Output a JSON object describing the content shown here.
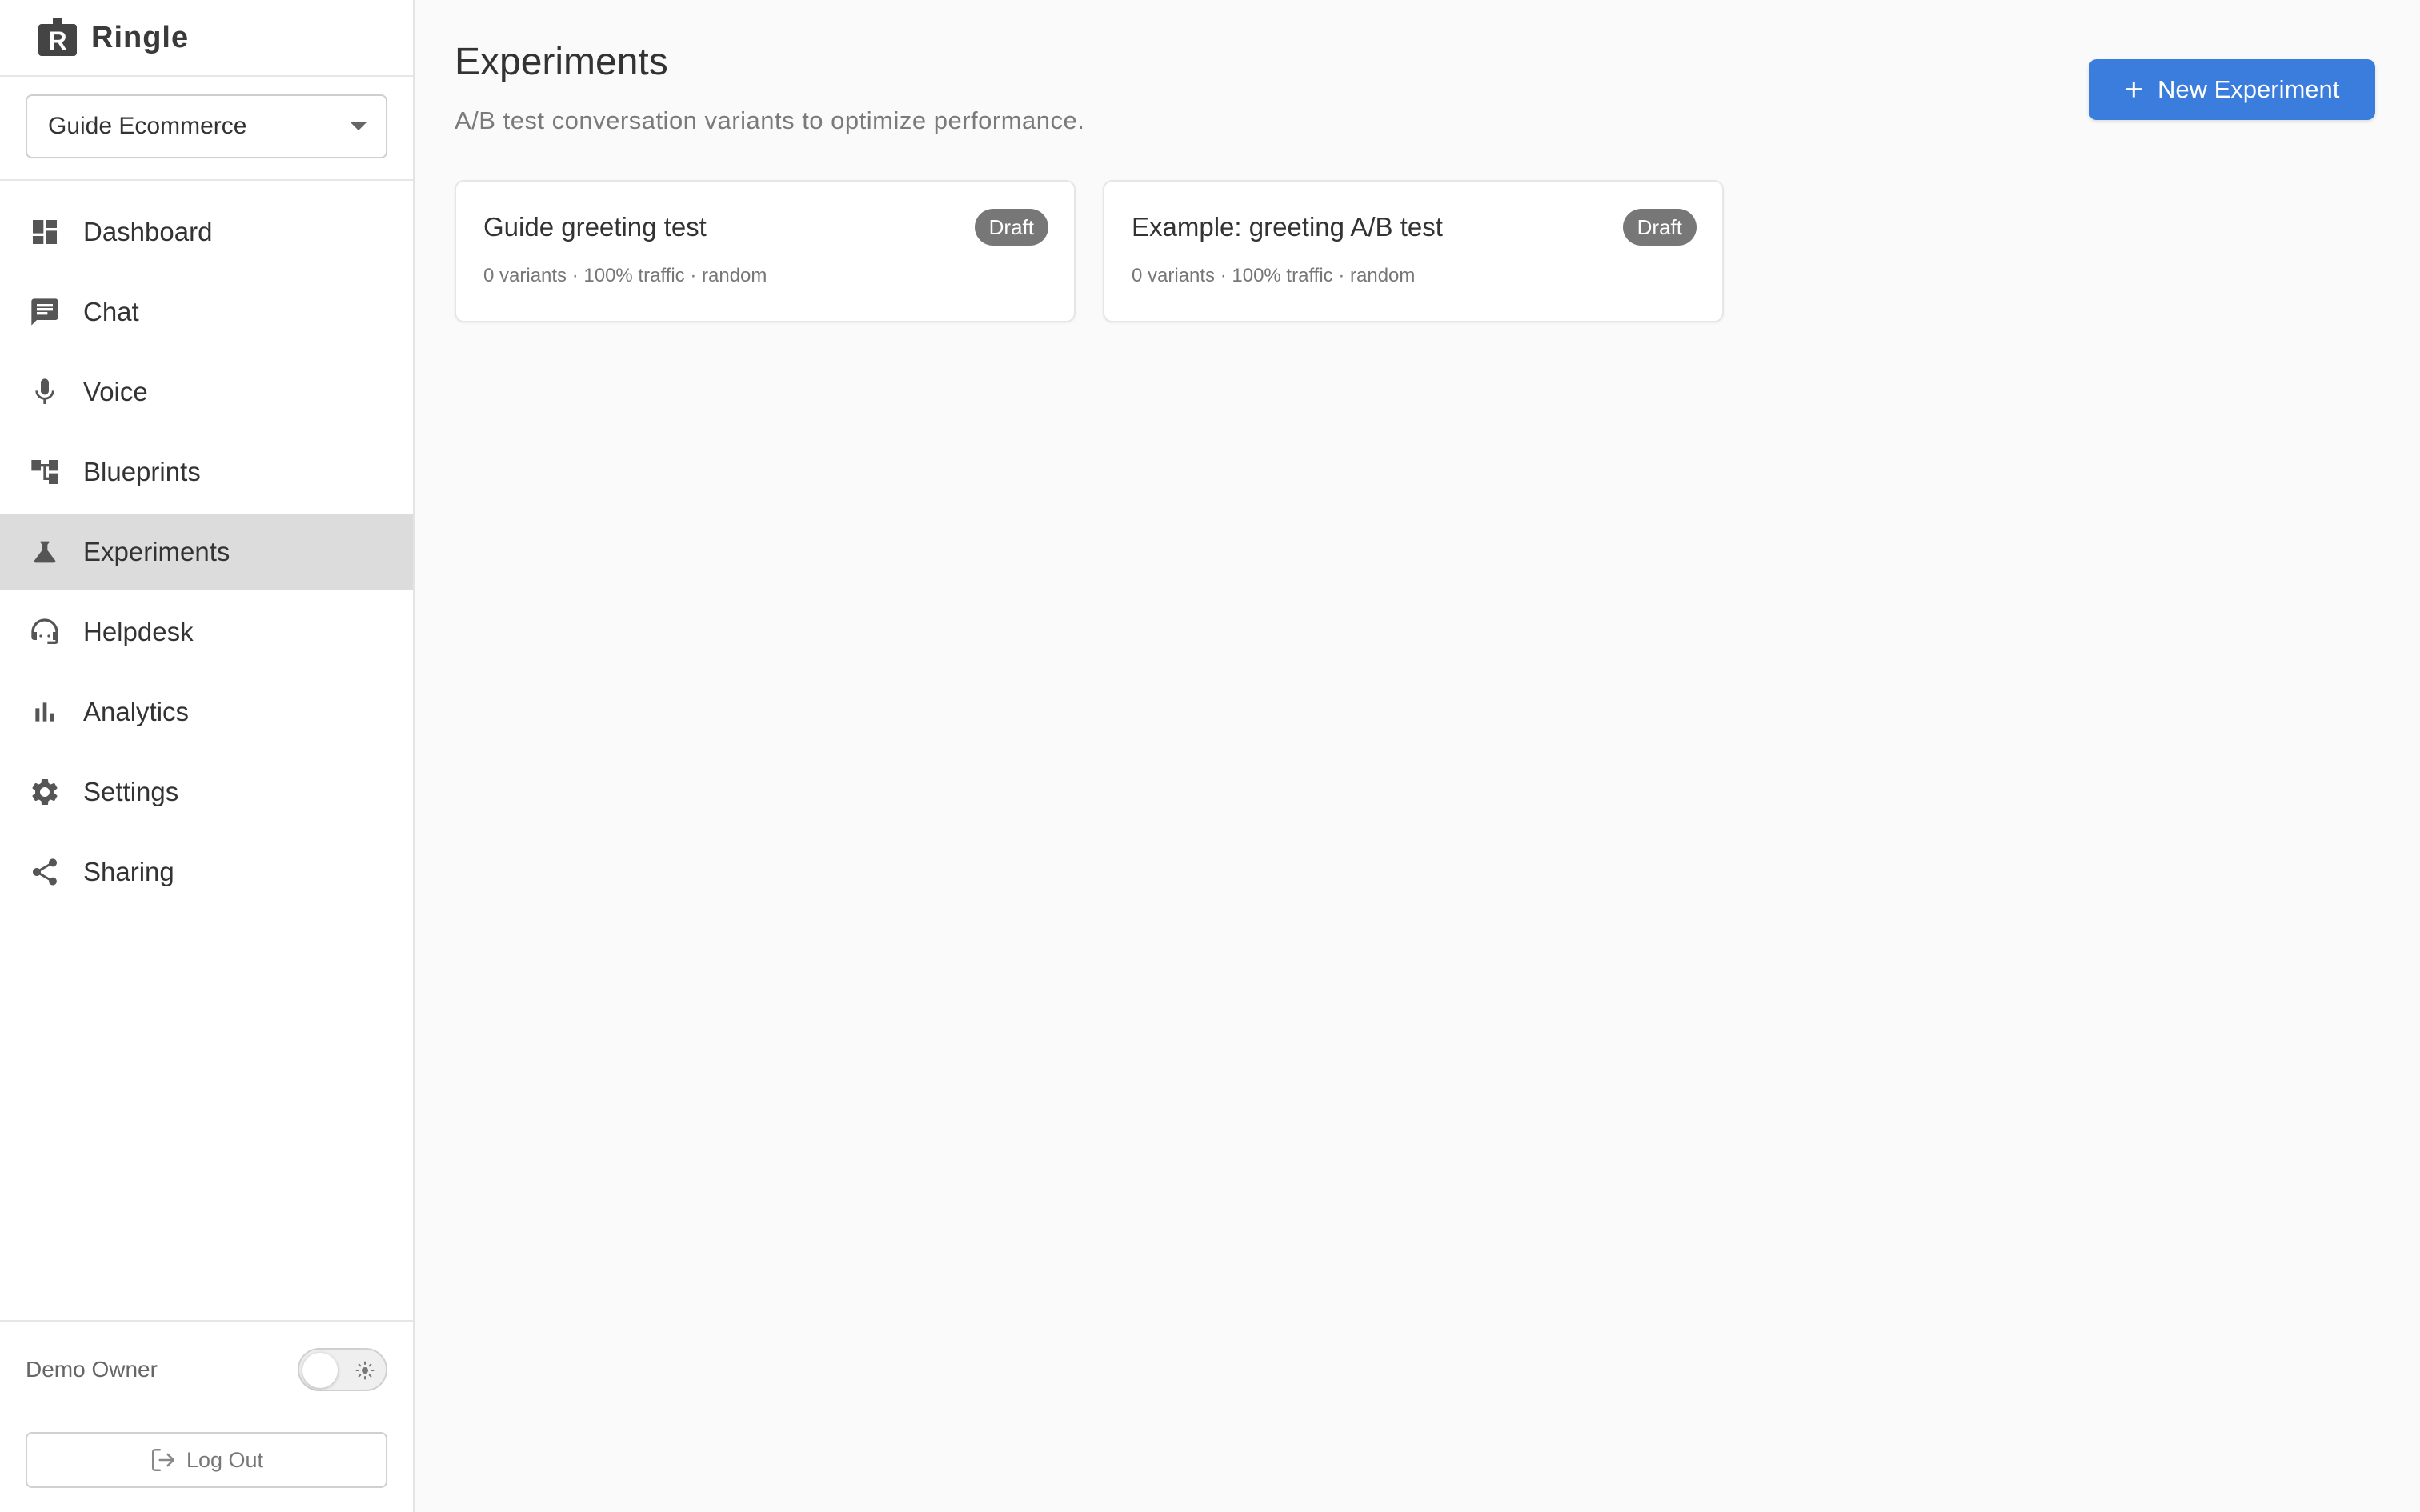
{
  "brand": {
    "name": "Ringle"
  },
  "workspace": {
    "selected": "Guide Ecommerce"
  },
  "nav": {
    "items": [
      {
        "label": "Dashboard",
        "icon": "dashboard-icon"
      },
      {
        "label": "Chat",
        "icon": "chat-icon"
      },
      {
        "label": "Voice",
        "icon": "mic-icon"
      },
      {
        "label": "Blueprints",
        "icon": "blueprint-icon"
      },
      {
        "label": "Experiments",
        "icon": "flask-icon",
        "active": true
      },
      {
        "label": "Helpdesk",
        "icon": "headset-icon"
      },
      {
        "label": "Analytics",
        "icon": "bar-chart-icon"
      },
      {
        "label": "Settings",
        "icon": "gear-icon"
      },
      {
        "label": "Sharing",
        "icon": "share-icon"
      }
    ]
  },
  "footer": {
    "user_name": "Demo Owner",
    "theme_toggle": "sun-icon",
    "logout_label": "Log Out"
  },
  "main": {
    "title": "Experiments",
    "subtitle": "A/B test conversation variants to optimize performance.",
    "new_button_label": "New Experiment",
    "cards": [
      {
        "title": "Guide greeting test",
        "meta": "0 variants · 100% traffic · random",
        "status": "Draft"
      },
      {
        "title": "Example: greeting A/B test",
        "meta": "0 variants · 100% traffic · random",
        "status": "Draft"
      }
    ]
  },
  "colors": {
    "accent": "#3b7ddd",
    "active_nav_bg": "#dcdcdc",
    "badge_bg": "#777777"
  }
}
